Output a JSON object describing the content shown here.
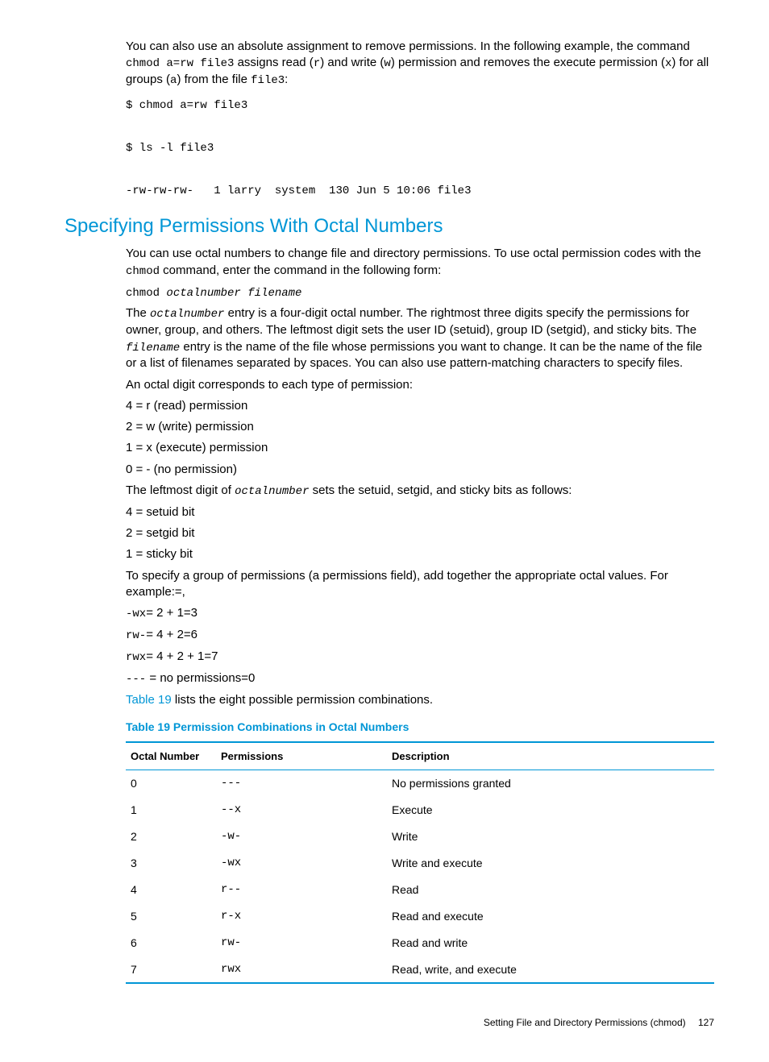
{
  "intro": {
    "p1a": "You can also use an absolute assignment to remove permissions. In the following example, the command ",
    "cmd1": "chmod a=rw file3",
    "p1b": " assigns read (",
    "r": "r",
    "p1c": ") and write (",
    "w": "w",
    "p1d": ") permission and removes the execute permission (",
    "x": "x",
    "p1e": ") for all groups (",
    "a": "a",
    "p1f": ") from the file ",
    "file3": "file3",
    "p1g": ":"
  },
  "codeblock1": "$ chmod a=rw file3\n\n$ ls -l file3\n\n-rw-rw-rw-   1 larry  system  130 Jun 5 10:06 file3",
  "heading": "Specifying Permissions With Octal Numbers",
  "para2a": "You can use octal numbers to change file and directory permissions. To use octal permission codes with the ",
  "chmod": "chmod",
  "para2b": " command, enter the command in the following form:",
  "syntax": {
    "cmd": "chmod ",
    "args": "octalnumber filename"
  },
  "para3a": "The ",
  "octalnumber": "octalnumber",
  "para3b": " entry is a four-digit octal number. The rightmost three digits specify the permissions for owner, group, and others. The leftmost digit sets the user ID (setuid), group ID (setgid), and sticky bits. The ",
  "filename": "filename",
  "para3c": " entry is the name of the file whose permissions you want to change. It can be the name of the file or a list of filenames separated by spaces. You can also use pattern-matching characters to specify files.",
  "para4": "An octal digit corresponds to each type of permission:",
  "perm_lines": [
    "4 = r (read) permission",
    "2 = w (write) permission",
    "1 = x (execute) permission",
    "0 = - (no permission)"
  ],
  "para5a": "The leftmost digit of ",
  "para5b": " sets the setuid, setgid, and sticky bits as follows:",
  "bit_lines": [
    "4 = setuid bit",
    "2 = setgid bit",
    "1 = sticky bit"
  ],
  "para6": "To specify a group of permissions (a permissions field), add together the appropriate octal values. For example:=,",
  "examples": [
    {
      "code": "-wx",
      "rest": "= 2 + 1=3"
    },
    {
      "code": "rw-",
      "rest": "= 4 + 2=6"
    },
    {
      "code": "rwx",
      "rest": "= 4 + 2 + 1=7"
    },
    {
      "code": "---",
      "rest": " = no permissions=0"
    }
  ],
  "para7_link": "Table 19",
  "para7_rest": " lists the eight possible permission combinations.",
  "table_caption": "Table 19 Permission Combinations in Octal Numbers",
  "table": {
    "headers": [
      "Octal Number",
      "Permissions",
      "Description"
    ],
    "rows": [
      {
        "oct": "0",
        "perm": "---",
        "desc": "No permissions granted"
      },
      {
        "oct": "1",
        "perm": "--x",
        "desc": "Execute"
      },
      {
        "oct": "2",
        "perm": "-w-",
        "desc": "Write"
      },
      {
        "oct": "3",
        "perm": "-wx",
        "desc": "Write and execute"
      },
      {
        "oct": "4",
        "perm": "r--",
        "desc": "Read"
      },
      {
        "oct": "5",
        "perm": "r-x",
        "desc": "Read and execute"
      },
      {
        "oct": "6",
        "perm": "rw-",
        "desc": "Read and write"
      },
      {
        "oct": "7",
        "perm": "rwx",
        "desc": "Read, write, and execute"
      }
    ]
  },
  "footer": {
    "text": "Setting File and Directory Permissions (chmod)",
    "page": "127"
  }
}
